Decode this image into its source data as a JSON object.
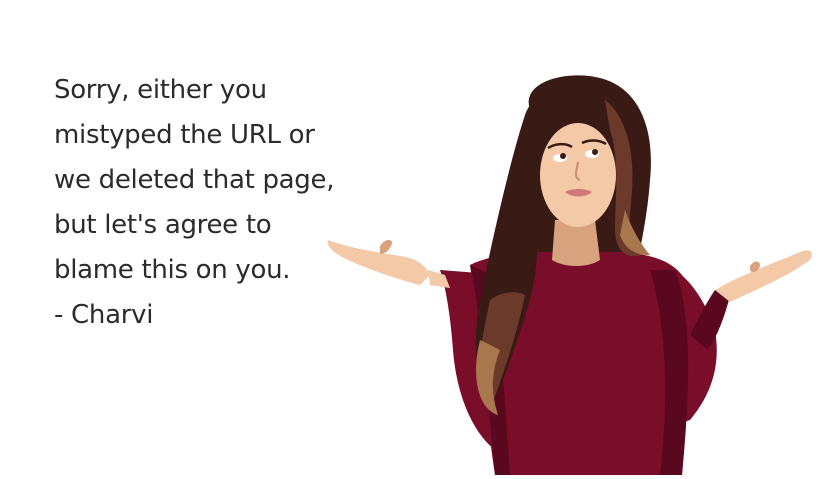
{
  "message": {
    "lines": [
      "Sorry, either you",
      "mistyped the URL or",
      "we deleted that page,",
      "but let's agree to",
      "blame this on you.",
      "- Charvi"
    ]
  },
  "illustration": {
    "icon": "shrugging-woman-illustration",
    "colors": {
      "sweater": "#7a0d2a",
      "sweater_shadow": "#5a0820",
      "hair_dark": "#3a1a14",
      "hair_mid": "#6b3a2a",
      "hair_light": "#a8774e",
      "skin": "#f3c9a7",
      "skin_shadow": "#d9a27f"
    }
  }
}
